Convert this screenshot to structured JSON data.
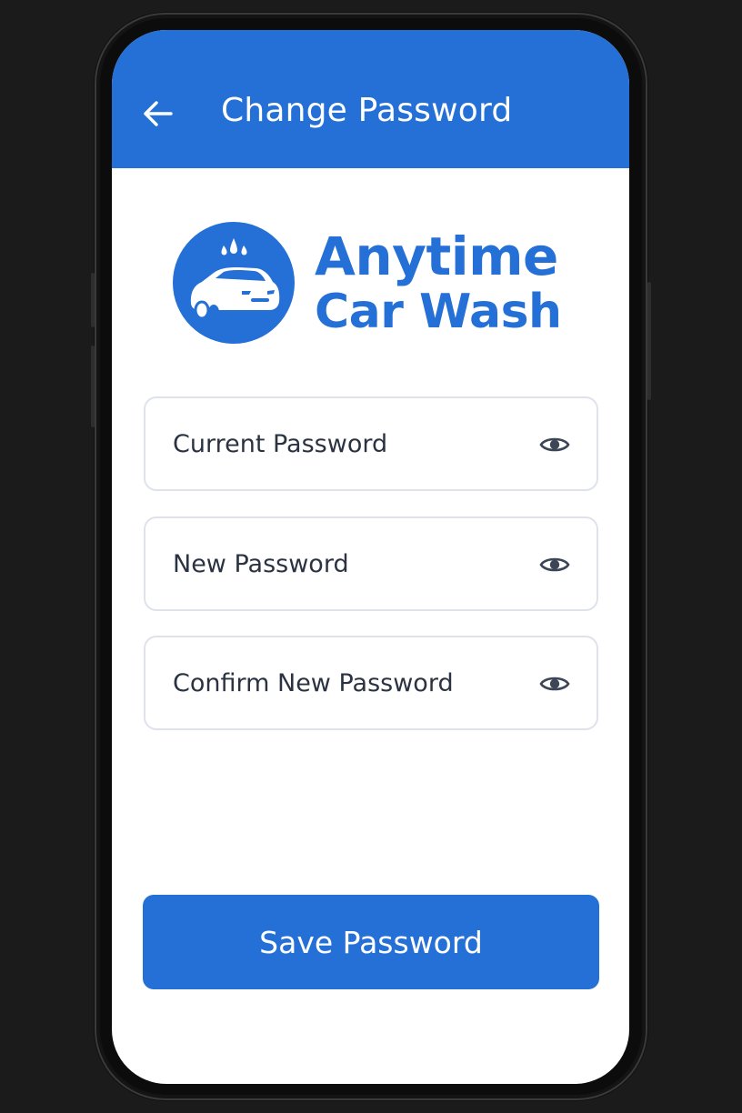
{
  "header": {
    "title": "Change Password",
    "back_icon": "arrow-left-icon"
  },
  "brand": {
    "line1": "Anytime",
    "line2": "Car Wash",
    "logo_icon": "car-wash-logo-icon"
  },
  "form": {
    "fields": [
      {
        "placeholder": "Current Password",
        "value": "",
        "toggle_icon": "eye-icon"
      },
      {
        "placeholder": "New Password",
        "value": "",
        "toggle_icon": "eye-icon"
      },
      {
        "placeholder": "Confirm New Password",
        "value": "",
        "toggle_icon": "eye-icon"
      }
    ]
  },
  "actions": {
    "save_label": "Save Password"
  },
  "colors": {
    "primary": "#2470d6",
    "background": "#ffffff",
    "field_border": "#dfe2ea",
    "field_text": "#2b3342",
    "icon": "#3c4657",
    "device_bezel": "#0c0c0c",
    "page_background": "#1b1b1b"
  }
}
